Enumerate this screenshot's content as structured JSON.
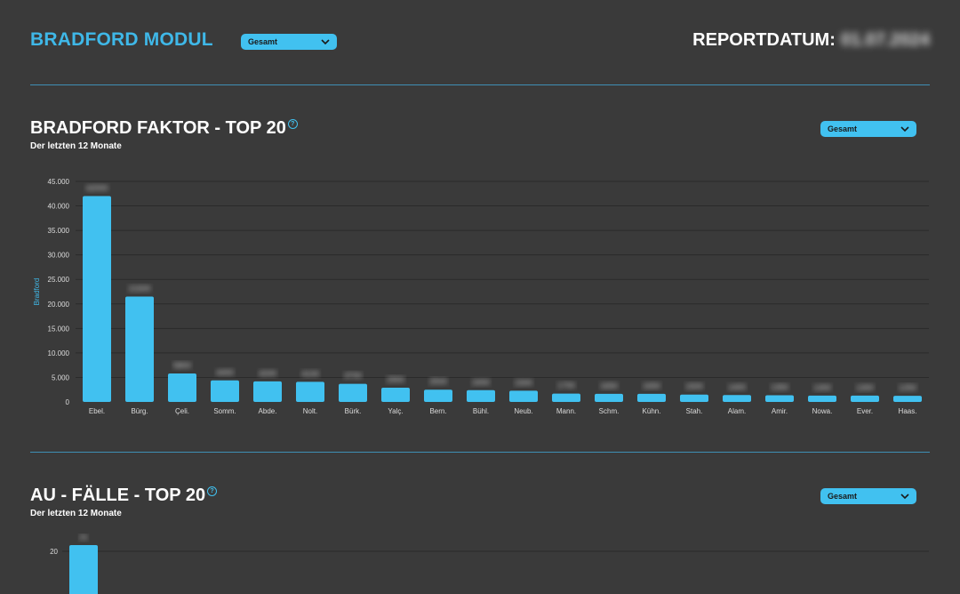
{
  "header": {
    "title": "BRADFORD MODUL",
    "filter": "Gesamt",
    "report_label": "REPORTDATUM:",
    "report_date": "01.07.2024"
  },
  "section1": {
    "title": "BRADFORD FAKTOR - TOP 20",
    "help": "?",
    "subtitle": "Der letzten 12 Monate",
    "filter": "Gesamt"
  },
  "section2": {
    "title": "AU - FÄLLE - TOP 20",
    "help": "?",
    "subtitle": "Der letzten 12 Monate",
    "filter": "Gesamt"
  },
  "colors": {
    "accent": "#41c1f0",
    "background": "#3a3a3a",
    "divider": "#3f8fb5"
  },
  "chart_data": [
    {
      "type": "bar",
      "title": "BRADFORD FAKTOR - TOP 20",
      "ylabel": "Bradford",
      "xlabel": "",
      "ylim": [
        0,
        45000
      ],
      "yticks": [
        0,
        5000,
        10000,
        15000,
        20000,
        25000,
        30000,
        35000,
        40000,
        45000
      ],
      "ytick_labels": [
        "0",
        "5.000",
        "10.000",
        "15.000",
        "20.000",
        "25.000",
        "30.000",
        "35.000",
        "40.000",
        "45.000"
      ],
      "grid": true,
      "categories": [
        "Ebel.",
        "Bürg.",
        "Çeli.",
        "Somm.",
        "Abde.",
        "Nolt.",
        "Bürk.",
        "Yalç.",
        "Bern.",
        "Bühl.",
        "Neub.",
        "Mann.",
        "Schm.",
        "Kühn.",
        "Stah.",
        "Alam.",
        "Amir.",
        "Nowa.",
        "Ever.",
        "Haas."
      ],
      "values": [
        42000,
        21500,
        5800,
        4400,
        4200,
        4100,
        3700,
        2900,
        2500,
        2400,
        2300,
        1700,
        1650,
        1650,
        1500,
        1400,
        1350,
        1300,
        1300,
        1250
      ]
    },
    {
      "type": "bar",
      "title": "AU - FÄLLE - TOP 20",
      "ylabel": "",
      "yticks": [
        20
      ],
      "ytick_labels": [
        "20"
      ],
      "grid": true,
      "categories": [],
      "values": [
        21
      ]
    }
  ]
}
